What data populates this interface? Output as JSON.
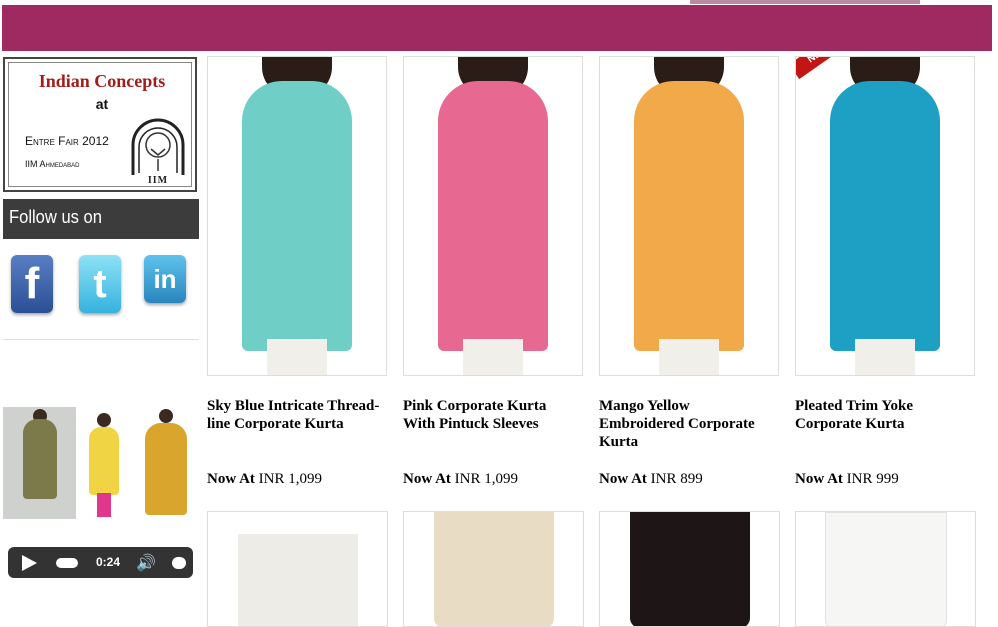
{
  "promo": {
    "brand": "Indian Concepts",
    "at": "at",
    "event": "Entre Fair 2012",
    "institute": "IIM Ahmedabad",
    "logo_text": "IIM"
  },
  "follow": {
    "label": "Follow us on"
  },
  "social": [
    {
      "name": "facebook",
      "glyph": "f"
    },
    {
      "name": "twitter",
      "glyph": "t"
    },
    {
      "name": "linkedin",
      "glyph": "in"
    }
  ],
  "player": {
    "time": "0:24"
  },
  "products": [
    {
      "title": "Sky Blue Intricate Thread-line Corporate Kurta",
      "price_prefix": "Now At",
      "price": "INR 1,099",
      "color": "#6fcfc6"
    },
    {
      "title": "Pink Corporate Kurta With Pintuck Sleeves",
      "price_prefix": "Now At",
      "price": "INR 1,099",
      "color": "#e76991"
    },
    {
      "title": "Mango Yellow Embroidered Corporate Kurta",
      "price_prefix": "Now At",
      "price": "INR 899",
      "color": "#f2a94a"
    },
    {
      "title": "Pleated Trim Yoke Corporate Kurta",
      "price_prefix": "Now At",
      "price": "INR 999",
      "color": "#1e9fc4",
      "badge": "NEW"
    }
  ],
  "bottom_products": [
    {
      "color": "#eeece6"
    },
    {
      "color": "#e9dcc4"
    },
    {
      "color": "#1e1616"
    },
    {
      "color": "#f6f6f4"
    }
  ],
  "colors": {
    "banner": "#9f2a62",
    "follow_bg": "#3c3c3c"
  }
}
